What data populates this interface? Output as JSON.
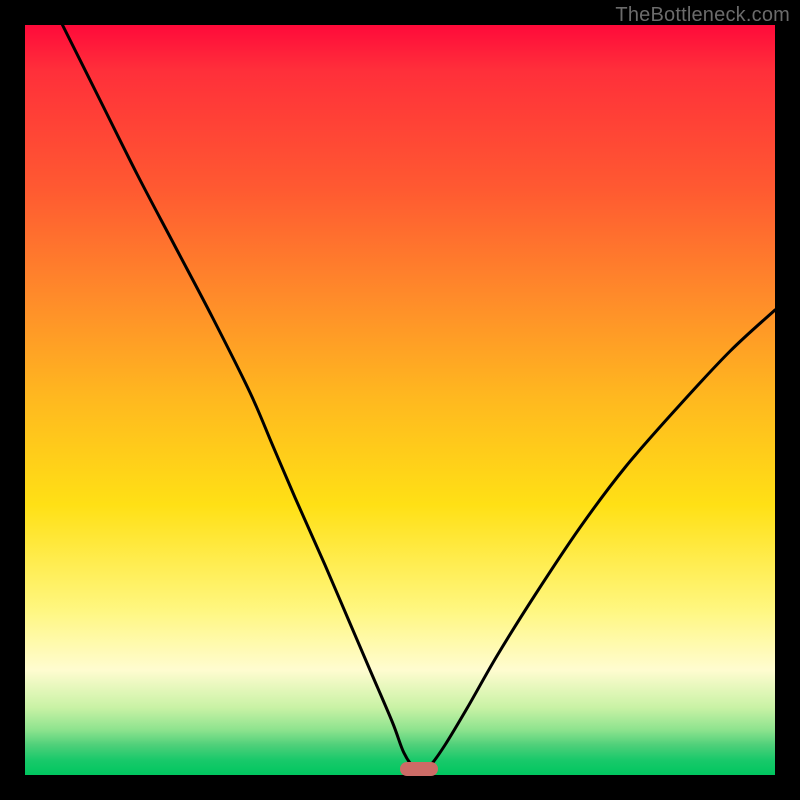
{
  "watermark": "TheBottleneck.com",
  "chart_data": {
    "type": "line",
    "title": "",
    "xlabel": "",
    "ylabel": "",
    "xlim": [
      0,
      100
    ],
    "ylim": [
      0,
      100
    ],
    "grid": false,
    "legend": false,
    "series": [
      {
        "name": "bottleneck-curve",
        "x": [
          5,
          10,
          15,
          20,
          25,
          30,
          33,
          36,
          40,
          43,
          46,
          49,
          50.5,
          52,
          53,
          54,
          56,
          59,
          63,
          68,
          74,
          80,
          87,
          94,
          100
        ],
        "y": [
          100,
          90,
          80,
          70.5,
          61,
          51,
          44,
          37,
          28,
          21,
          14,
          7,
          3,
          0.8,
          0.5,
          1.2,
          4,
          9,
          16,
          24,
          33,
          41,
          49,
          56.5,
          62
        ]
      }
    ],
    "marker": {
      "x": 52.5,
      "y": 0.8,
      "color": "#cc6b66"
    },
    "background_gradient": {
      "top": "#ff0a3a",
      "bottom": "#00c65f"
    }
  }
}
